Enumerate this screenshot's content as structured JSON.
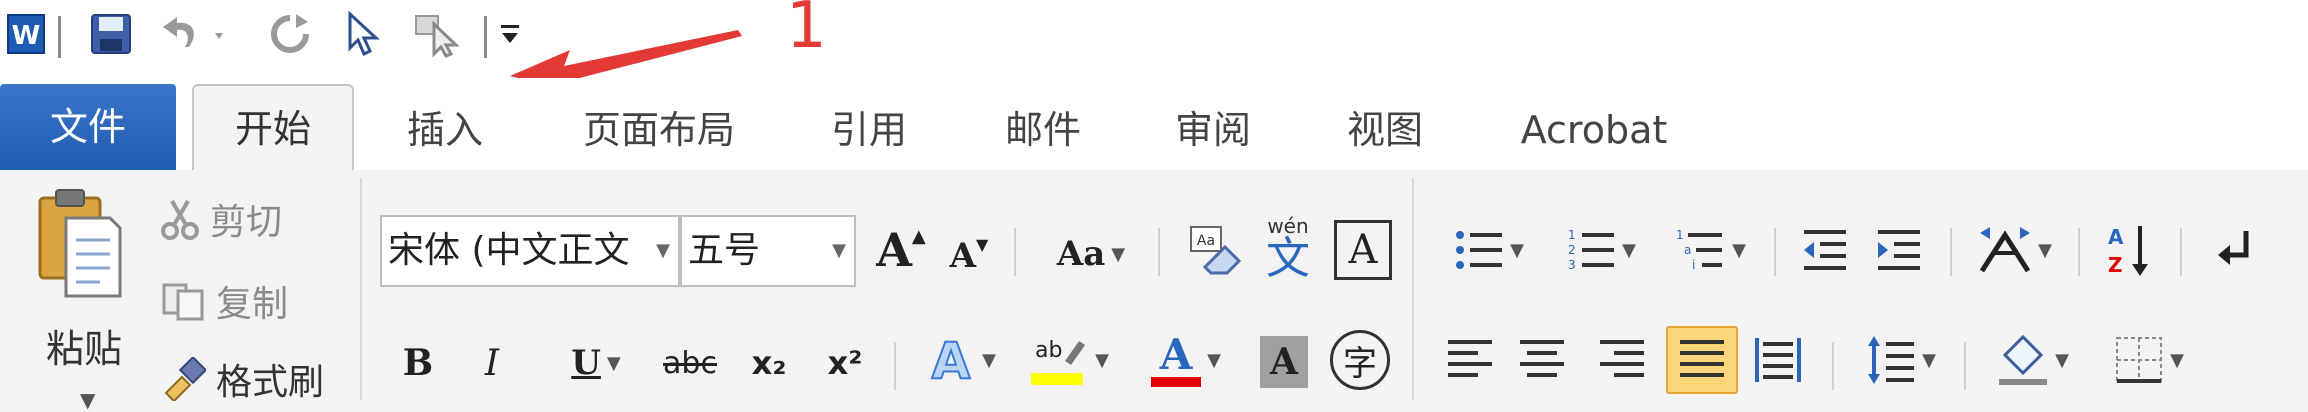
{
  "annotation": {
    "number": "1"
  },
  "tabs": {
    "file": "文件",
    "home": "开始",
    "insert": "插入",
    "page_layout": "页面布局",
    "references": "引用",
    "mailings": "邮件",
    "review": "审阅",
    "view": "视图",
    "acrobat": "Acrobat"
  },
  "clipboard": {
    "paste": "粘贴",
    "cut": "剪切",
    "copy": "复制",
    "format_painter": "格式刷"
  },
  "font": {
    "family": "宋体 (中文正文",
    "size": "五号",
    "bold": "B",
    "italic": "I",
    "underline": "U",
    "strikethrough": "abc",
    "subscript": "x₂",
    "superscript": "x²",
    "change_case": "Aa",
    "font_color": "A",
    "char_shading": "A",
    "enclose_char": "字",
    "phonetic_top": "wén",
    "phonetic_char": "文",
    "char_border": "A"
  },
  "colors": {
    "file_tab": "#2a66bd",
    "highlight": "#ffff00",
    "font_color": "#e00000",
    "justify_active": "#fcd77a",
    "annotation": "#e53935"
  }
}
